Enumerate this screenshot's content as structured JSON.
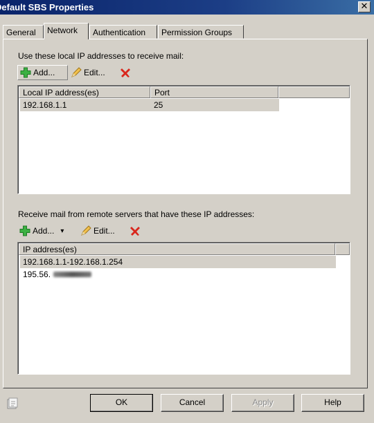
{
  "window": {
    "title": "Default SBS Properties",
    "close_glyph": "✕"
  },
  "tabs": [
    {
      "label": "General"
    },
    {
      "label": "Network"
    },
    {
      "label": "Authentication"
    },
    {
      "label": "Permission Groups"
    }
  ],
  "local_section": {
    "heading": "Use these local IP addresses to receive mail:",
    "toolbar": {
      "add_label": "Add...",
      "edit_label": "Edit..."
    },
    "columns": [
      "Local IP address(es)",
      "Port"
    ],
    "rows": [
      {
        "ip": "192.168.1.1",
        "port": "25"
      }
    ]
  },
  "remote_section": {
    "heading": "Receive mail from remote servers that have these IP addresses:",
    "toolbar": {
      "add_label": "Add...",
      "add_menu_glyph": "▾",
      "edit_label": "Edit..."
    },
    "columns": [
      "IP address(es)"
    ],
    "rows": [
      {
        "ip": "192.168.1.1-192.168.1.254"
      },
      {
        "ip": "195.56."
      }
    ]
  },
  "buttons": {
    "ok": "OK",
    "cancel": "Cancel",
    "apply": "Apply",
    "help": "Help"
  },
  "colors": {
    "titlebar": "#0a246a",
    "face": "#d4d0c8",
    "add_icon": "#3cb043",
    "remove_icon": "#d9261c"
  },
  "icons": [
    "close-icon",
    "add-icon",
    "edit-icon",
    "remove-icon",
    "dropdown-arrow-icon",
    "help-context-icon"
  ]
}
